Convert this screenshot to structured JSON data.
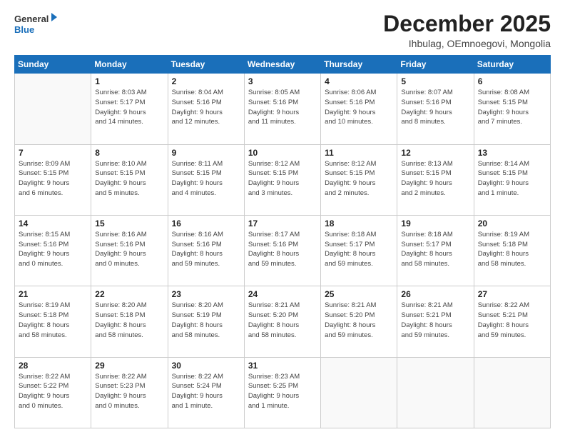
{
  "logo": {
    "general": "General",
    "blue": "Blue"
  },
  "title": "December 2025",
  "subtitle": "Ihbulag, OEmnoegovi, Mongolia",
  "headers": [
    "Sunday",
    "Monday",
    "Tuesday",
    "Wednesday",
    "Thursday",
    "Friday",
    "Saturday"
  ],
  "weeks": [
    [
      {
        "day": "",
        "info": ""
      },
      {
        "day": "1",
        "info": "Sunrise: 8:03 AM\nSunset: 5:17 PM\nDaylight: 9 hours\nand 14 minutes."
      },
      {
        "day": "2",
        "info": "Sunrise: 8:04 AM\nSunset: 5:16 PM\nDaylight: 9 hours\nand 12 minutes."
      },
      {
        "day": "3",
        "info": "Sunrise: 8:05 AM\nSunset: 5:16 PM\nDaylight: 9 hours\nand 11 minutes."
      },
      {
        "day": "4",
        "info": "Sunrise: 8:06 AM\nSunset: 5:16 PM\nDaylight: 9 hours\nand 10 minutes."
      },
      {
        "day": "5",
        "info": "Sunrise: 8:07 AM\nSunset: 5:16 PM\nDaylight: 9 hours\nand 8 minutes."
      },
      {
        "day": "6",
        "info": "Sunrise: 8:08 AM\nSunset: 5:15 PM\nDaylight: 9 hours\nand 7 minutes."
      }
    ],
    [
      {
        "day": "7",
        "info": "Sunrise: 8:09 AM\nSunset: 5:15 PM\nDaylight: 9 hours\nand 6 minutes."
      },
      {
        "day": "8",
        "info": "Sunrise: 8:10 AM\nSunset: 5:15 PM\nDaylight: 9 hours\nand 5 minutes."
      },
      {
        "day": "9",
        "info": "Sunrise: 8:11 AM\nSunset: 5:15 PM\nDaylight: 9 hours\nand 4 minutes."
      },
      {
        "day": "10",
        "info": "Sunrise: 8:12 AM\nSunset: 5:15 PM\nDaylight: 9 hours\nand 3 minutes."
      },
      {
        "day": "11",
        "info": "Sunrise: 8:12 AM\nSunset: 5:15 PM\nDaylight: 9 hours\nand 2 minutes."
      },
      {
        "day": "12",
        "info": "Sunrise: 8:13 AM\nSunset: 5:15 PM\nDaylight: 9 hours\nand 2 minutes."
      },
      {
        "day": "13",
        "info": "Sunrise: 8:14 AM\nSunset: 5:15 PM\nDaylight: 9 hours\nand 1 minute."
      }
    ],
    [
      {
        "day": "14",
        "info": "Sunrise: 8:15 AM\nSunset: 5:16 PM\nDaylight: 9 hours\nand 0 minutes."
      },
      {
        "day": "15",
        "info": "Sunrise: 8:16 AM\nSunset: 5:16 PM\nDaylight: 9 hours\nand 0 minutes."
      },
      {
        "day": "16",
        "info": "Sunrise: 8:16 AM\nSunset: 5:16 PM\nDaylight: 8 hours\nand 59 minutes."
      },
      {
        "day": "17",
        "info": "Sunrise: 8:17 AM\nSunset: 5:16 PM\nDaylight: 8 hours\nand 59 minutes."
      },
      {
        "day": "18",
        "info": "Sunrise: 8:18 AM\nSunset: 5:17 PM\nDaylight: 8 hours\nand 59 minutes."
      },
      {
        "day": "19",
        "info": "Sunrise: 8:18 AM\nSunset: 5:17 PM\nDaylight: 8 hours\nand 58 minutes."
      },
      {
        "day": "20",
        "info": "Sunrise: 8:19 AM\nSunset: 5:18 PM\nDaylight: 8 hours\nand 58 minutes."
      }
    ],
    [
      {
        "day": "21",
        "info": "Sunrise: 8:19 AM\nSunset: 5:18 PM\nDaylight: 8 hours\nand 58 minutes."
      },
      {
        "day": "22",
        "info": "Sunrise: 8:20 AM\nSunset: 5:18 PM\nDaylight: 8 hours\nand 58 minutes."
      },
      {
        "day": "23",
        "info": "Sunrise: 8:20 AM\nSunset: 5:19 PM\nDaylight: 8 hours\nand 58 minutes."
      },
      {
        "day": "24",
        "info": "Sunrise: 8:21 AM\nSunset: 5:20 PM\nDaylight: 8 hours\nand 58 minutes."
      },
      {
        "day": "25",
        "info": "Sunrise: 8:21 AM\nSunset: 5:20 PM\nDaylight: 8 hours\nand 59 minutes."
      },
      {
        "day": "26",
        "info": "Sunrise: 8:21 AM\nSunset: 5:21 PM\nDaylight: 8 hours\nand 59 minutes."
      },
      {
        "day": "27",
        "info": "Sunrise: 8:22 AM\nSunset: 5:21 PM\nDaylight: 8 hours\nand 59 minutes."
      }
    ],
    [
      {
        "day": "28",
        "info": "Sunrise: 8:22 AM\nSunset: 5:22 PM\nDaylight: 9 hours\nand 0 minutes."
      },
      {
        "day": "29",
        "info": "Sunrise: 8:22 AM\nSunset: 5:23 PM\nDaylight: 9 hours\nand 0 minutes."
      },
      {
        "day": "30",
        "info": "Sunrise: 8:22 AM\nSunset: 5:24 PM\nDaylight: 9 hours\nand 1 minute."
      },
      {
        "day": "31",
        "info": "Sunrise: 8:23 AM\nSunset: 5:25 PM\nDaylight: 9 hours\nand 1 minute."
      },
      {
        "day": "",
        "info": ""
      },
      {
        "day": "",
        "info": ""
      },
      {
        "day": "",
        "info": ""
      }
    ]
  ]
}
